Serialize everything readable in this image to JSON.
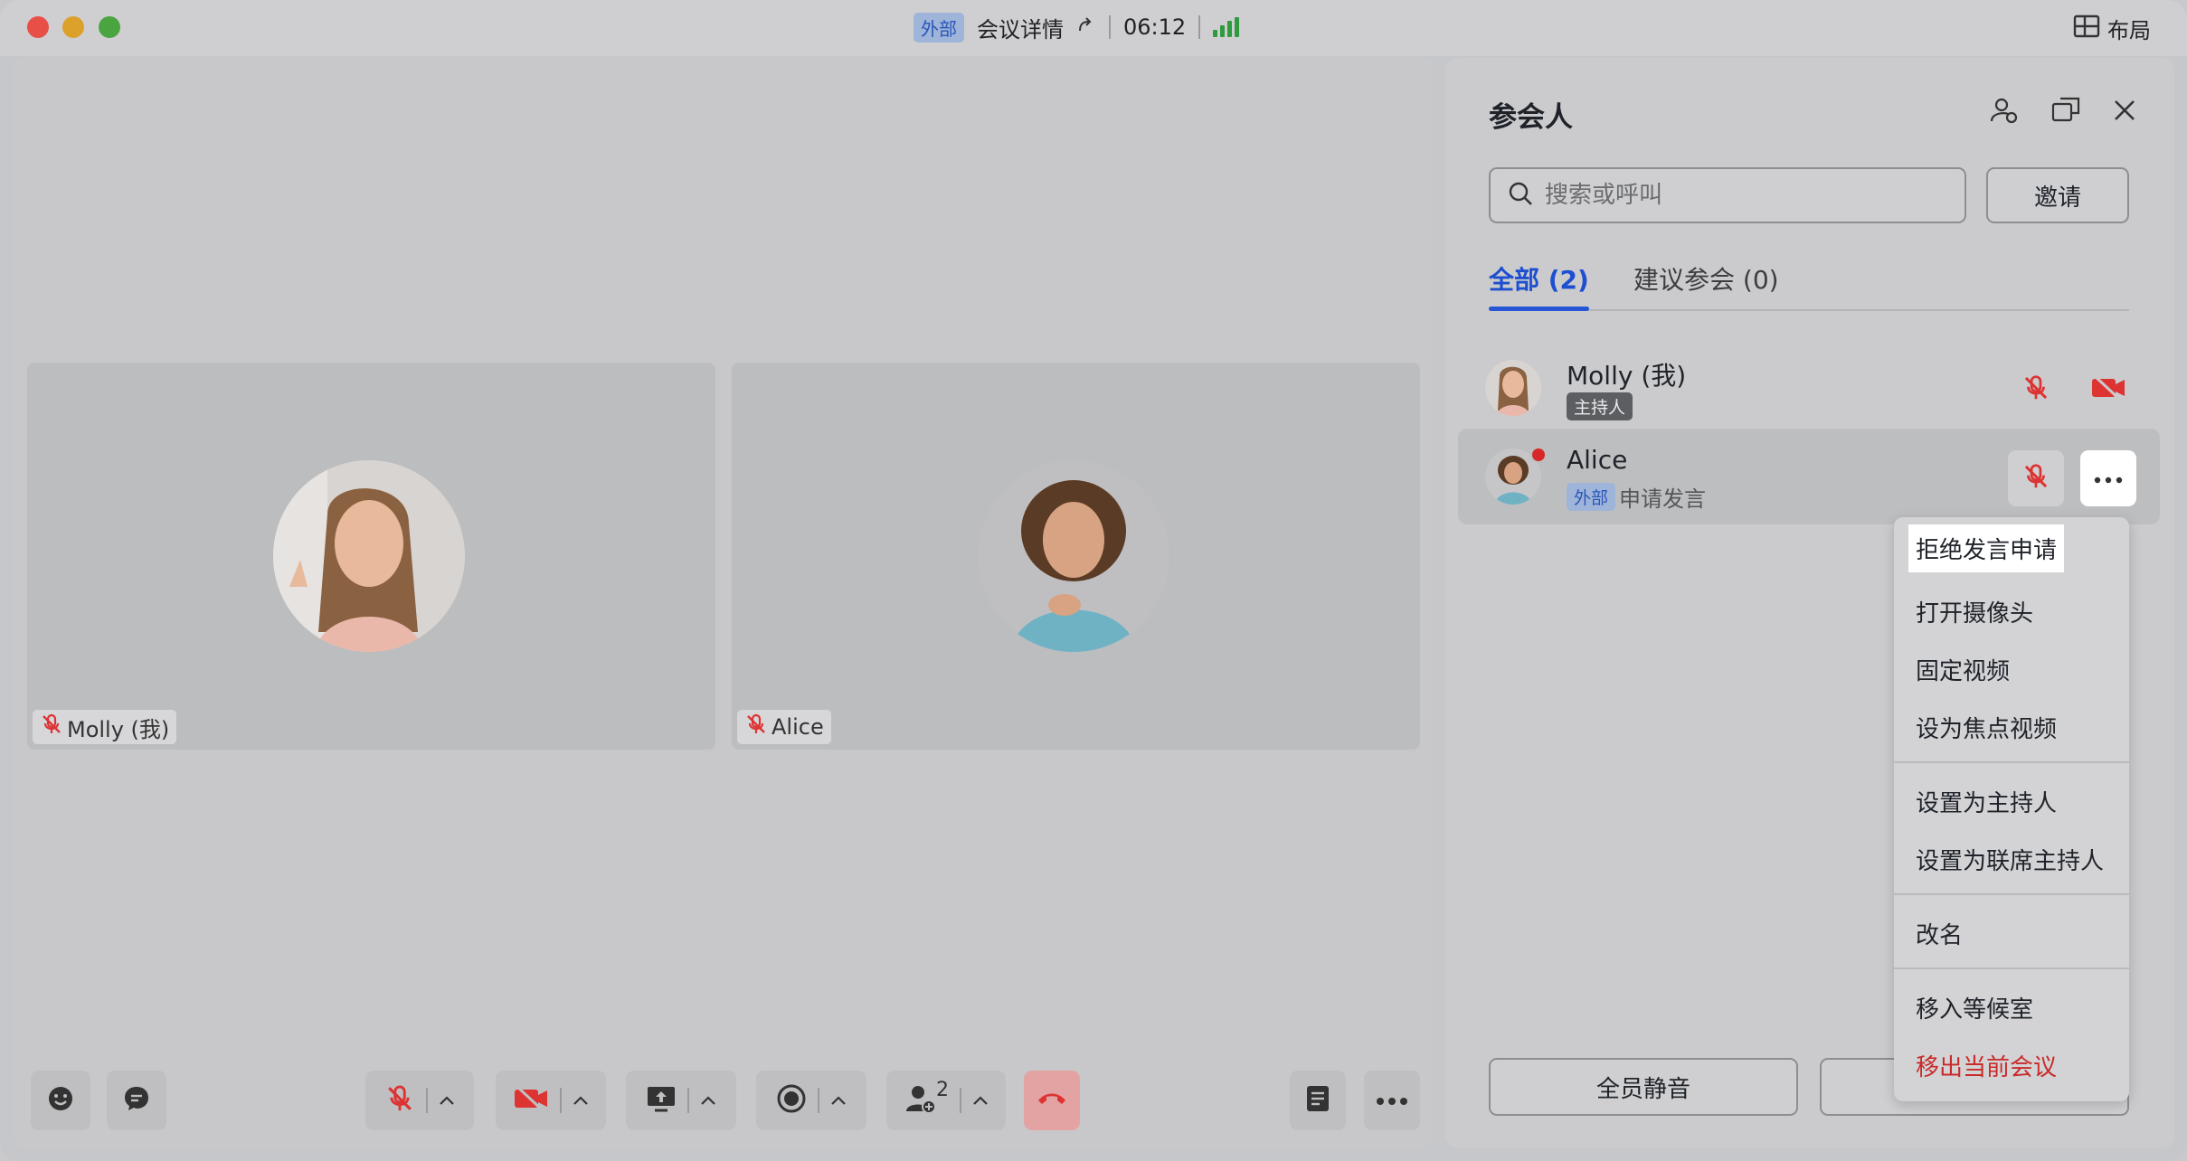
{
  "titlebar": {
    "tag": "外部",
    "title": "会议详情",
    "timer": "06:12",
    "layout_label": "布局"
  },
  "stage": {
    "tiles": [
      {
        "name": "Molly (我)"
      },
      {
        "name": "Alice"
      }
    ]
  },
  "panel": {
    "title": "参会人",
    "search_placeholder": "搜索或呼叫",
    "invite_label": "邀请",
    "tabs": [
      {
        "label": "全部 (2)"
      },
      {
        "label": "建议参会 (0)"
      }
    ],
    "participants": [
      {
        "name": "Molly (我)",
        "badge": "主持人"
      },
      {
        "name": "Alice",
        "badge": "外部",
        "status": "申请发言"
      }
    ],
    "mute_all_label": "全员静音"
  },
  "toolbar": {
    "participant_count": "2"
  },
  "menu": {
    "items": [
      "拒绝发言申请",
      "打开摄像头",
      "固定视频",
      "设为焦点视频",
      "设置为主持人",
      "设置为联席主持人",
      "改名",
      "移入等候室",
      "移出当前会议"
    ]
  },
  "colors": {
    "accent": "#2456d6",
    "danger": "#c92a2a",
    "hangup": "#e8a0a0",
    "signal": "#2f9a3f"
  }
}
